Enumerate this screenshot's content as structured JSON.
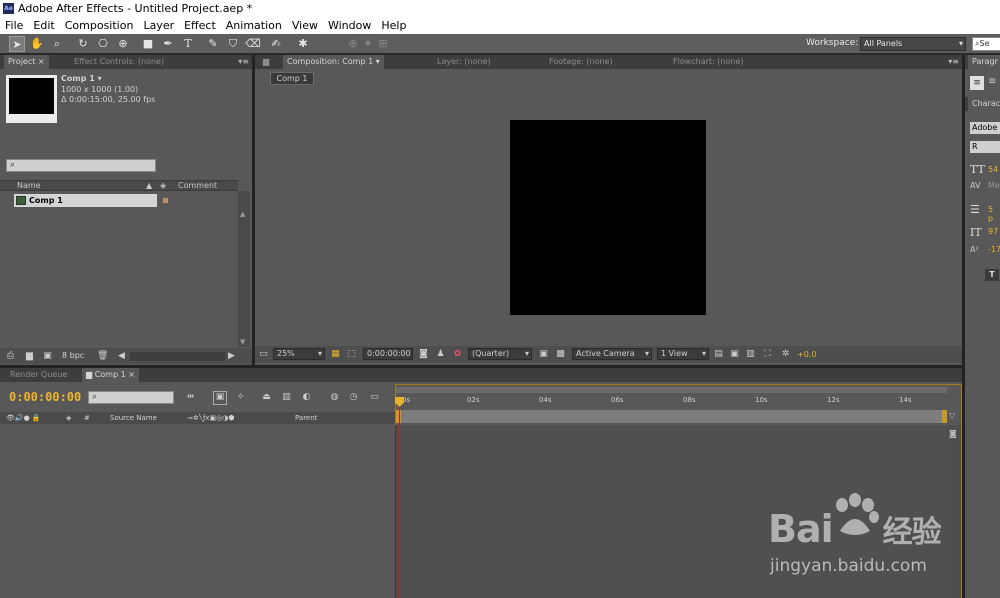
{
  "window": {
    "title": "Adobe After Effects - Untitled Project.aep *",
    "app_icon": "Ae"
  },
  "menu": [
    "File",
    "Edit",
    "Composition",
    "Layer",
    "Effect",
    "Animation",
    "View",
    "Window",
    "Help"
  ],
  "toolbar": {
    "workspace_label": "Workspace:",
    "workspace_value": "All Panels",
    "search_help": "Se"
  },
  "project_panel": {
    "tabs": [
      "Project",
      "Effect Controls: (none)"
    ],
    "item_name": "Comp 1 ▾",
    "item_size": "1000 x 1000 (1.00)",
    "item_duration": "Δ 0:00:15:00, 25.00 fps",
    "col_name": "Name",
    "col_comment": "Comment",
    "rows": [
      {
        "name": "Comp 1"
      }
    ],
    "bpc": "8 bpc"
  },
  "comp_panel": {
    "tabs": [
      "Composition: Comp 1",
      "Layer: (none)",
      "Footage: (none)",
      "Flowchart: (none)"
    ],
    "subtab": "Comp 1",
    "zoom": "25%",
    "timecode": "0:00:00:00",
    "resolution": "(Quarter)",
    "camera": "Active Camera",
    "views": "1 View",
    "exposure": "+0.0"
  },
  "right_panel": {
    "tab": "Paragr",
    "char_tab": "Charac",
    "font": "Adobe",
    "style": "R",
    "size": "54",
    "kerning": "Me",
    "stroke": "5 p",
    "scale": "97",
    "baseline": "-17"
  },
  "timeline": {
    "tabs": [
      "Render Queue",
      "Comp 1"
    ],
    "timecode": "0:00:00:00",
    "col_source": "Source Name",
    "col_parent": "Parent",
    "ticks": [
      "0s",
      "02s",
      "04s",
      "06s",
      "08s",
      "10s",
      "12s",
      "14s"
    ]
  },
  "watermark": {
    "brand": "Bai",
    "brand2": "经验",
    "url": "jingyan.baidu.com"
  },
  "colors": {
    "timecode": "#f0b42a",
    "playhead": "#d21818",
    "accent": "#a07a1e"
  }
}
